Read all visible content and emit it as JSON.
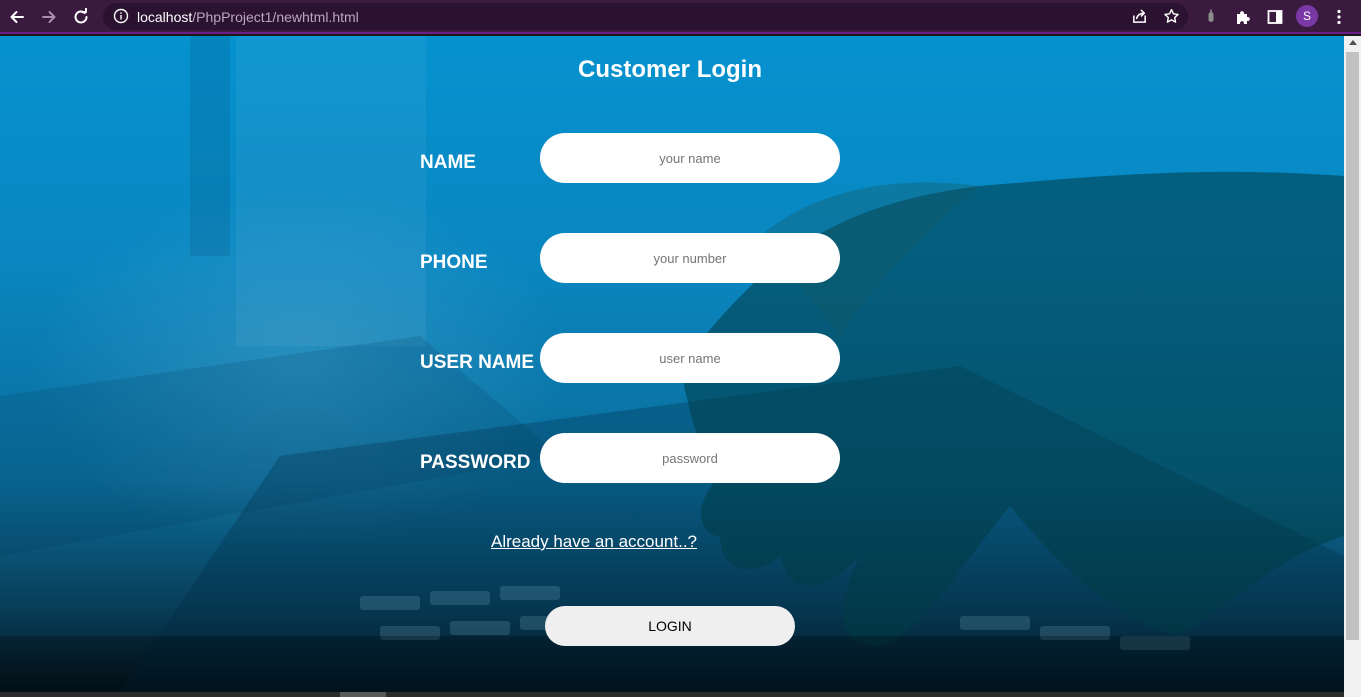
{
  "browser": {
    "url_host": "localhost",
    "url_path": "/PhpProject1/newhtml.html",
    "profile_initial": "S",
    "icons": [
      "back-icon",
      "forward-icon",
      "reload-icon",
      "site-info-icon",
      "share-icon",
      "bookmark-star-icon",
      "extension-icon",
      "puzzle-icon",
      "side-panel-icon",
      "menu-icon"
    ]
  },
  "page": {
    "title": "Customer Login",
    "fields": [
      {
        "label": "NAME",
        "placeholder": "your name"
      },
      {
        "label": "PHONE",
        "placeholder": "your number"
      },
      {
        "label": "USER NAME",
        "placeholder": "user name"
      },
      {
        "label": "PASSWORD",
        "placeholder": "password"
      }
    ],
    "account_link": "Already have an account..?",
    "login_button": "LOGIN"
  },
  "colors": {
    "chrome_bg": "#3b1a3f",
    "accent": "#7a37a6",
    "page_bg": "#0592cf"
  }
}
